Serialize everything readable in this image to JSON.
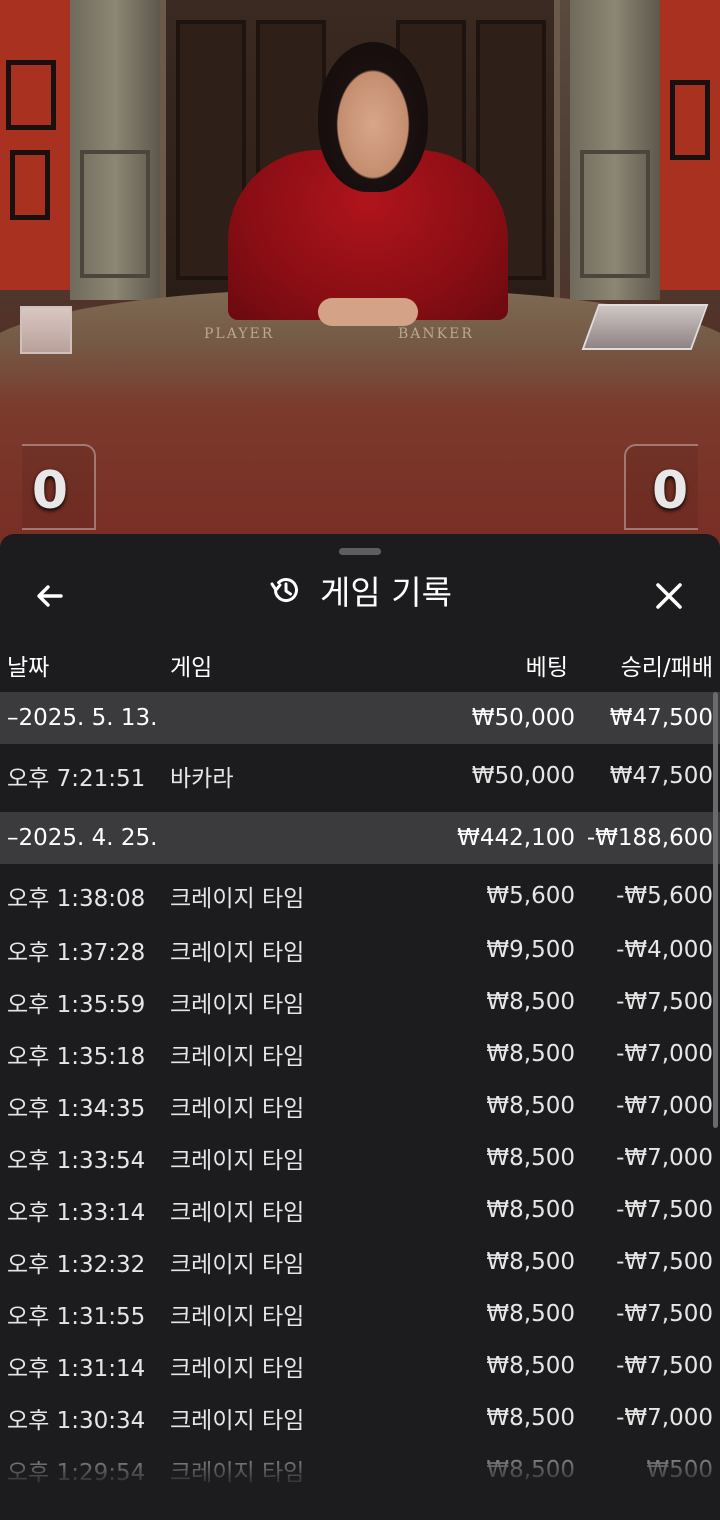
{
  "video": {
    "table_labels": [
      "PLAYER",
      "BANKER"
    ],
    "player_score": "0",
    "banker_score": "0"
  },
  "sheet": {
    "title": "게임 기록",
    "icons": {
      "back": "arrow-left-icon",
      "title": "history-icon",
      "close": "close-icon"
    },
    "columns": {
      "date": "날짜",
      "game": "게임",
      "bet": "베팅",
      "result": "승리/패배"
    },
    "rows": [
      {
        "type": "group",
        "date": "–2025. 5. 13.",
        "game": "",
        "bet": "₩50,000",
        "result": "₩47,500"
      },
      {
        "type": "item",
        "date": "오후 7:21:51",
        "game": "바카라",
        "bet": "₩50,000",
        "result": "₩47,500"
      },
      {
        "type": "group",
        "date": "–2025. 4. 25.",
        "game": "",
        "bet": "₩442,100",
        "result": "-₩188,600"
      },
      {
        "type": "item",
        "date": "오후 1:38:08",
        "game": "크레이지 타임",
        "bet": "₩5,600",
        "result": "-₩5,600"
      },
      {
        "type": "item",
        "date": "오후 1:37:28",
        "game": "크레이지 타임",
        "bet": "₩9,500",
        "result": "-₩4,000"
      },
      {
        "type": "item",
        "date": "오후 1:35:59",
        "game": "크레이지 타임",
        "bet": "₩8,500",
        "result": "-₩7,500"
      },
      {
        "type": "item",
        "date": "오후 1:35:18",
        "game": "크레이지 타임",
        "bet": "₩8,500",
        "result": "-₩7,000"
      },
      {
        "type": "item",
        "date": "오후 1:34:35",
        "game": "크레이지 타임",
        "bet": "₩8,500",
        "result": "-₩7,000"
      },
      {
        "type": "item",
        "date": "오후 1:33:54",
        "game": "크레이지 타임",
        "bet": "₩8,500",
        "result": "-₩7,000"
      },
      {
        "type": "item",
        "date": "오후 1:33:14",
        "game": "크레이지 타임",
        "bet": "₩8,500",
        "result": "-₩7,500"
      },
      {
        "type": "item",
        "date": "오후 1:32:32",
        "game": "크레이지 타임",
        "bet": "₩8,500",
        "result": "-₩7,500"
      },
      {
        "type": "item",
        "date": "오후 1:31:55",
        "game": "크레이지 타임",
        "bet": "₩8,500",
        "result": "-₩7,500"
      },
      {
        "type": "item",
        "date": "오후 1:31:14",
        "game": "크레이지 타임",
        "bet": "₩8,500",
        "result": "-₩7,500"
      },
      {
        "type": "item",
        "date": "오후 1:30:34",
        "game": "크레이지 타임",
        "bet": "₩8,500",
        "result": "-₩7,000"
      },
      {
        "type": "item",
        "date": "오후 1:29:54",
        "game": "크레이지 타임",
        "bet": "₩8,500",
        "result": "₩500"
      }
    ]
  }
}
